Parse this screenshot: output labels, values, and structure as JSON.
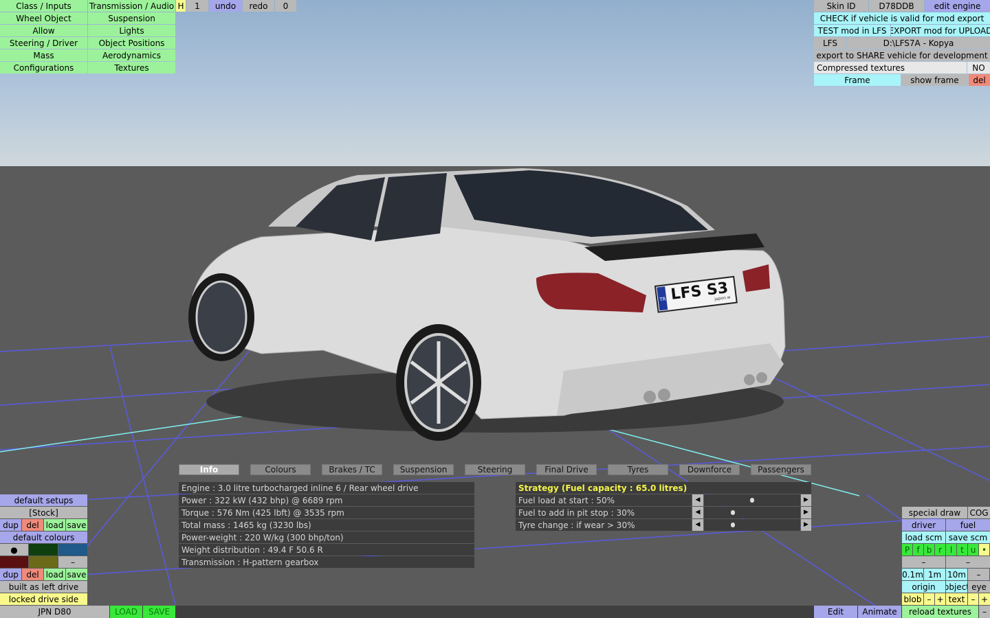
{
  "top_left_menu": [
    [
      "Class / Inputs",
      "Transmission / Audio"
    ],
    [
      "Wheel Object",
      "Suspension"
    ],
    [
      "Allow",
      "Lights"
    ],
    [
      "Steering / Driver",
      "Object Positions"
    ],
    [
      "Mass",
      "Aerodynamics"
    ],
    [
      "Configurations",
      "Textures"
    ]
  ],
  "history": {
    "h": "H",
    "count": "1",
    "undo": "undo",
    "redo": "redo",
    "redo_count": "0"
  },
  "top_right": {
    "skin_id_label": "Skin ID",
    "skin_id_value": "D78DDB",
    "edit_engine": "edit engine",
    "check_valid": "CHECK if vehicle is valid for mod export",
    "test_mod": "TEST mod in LFS",
    "export_mod": "EXPORT mod for UPLOAD",
    "lfs_label": "LFS",
    "lfs_path": "D:\\LFS7A - Kopya",
    "export_share": "export to SHARE vehicle for development",
    "compressed_label": "Compressed textures",
    "compressed_value": "NO",
    "frame": "Frame",
    "show_frame": "show frame",
    "del": "del"
  },
  "car": {
    "plate_text": "LFS S3",
    "plate_country": "TR",
    "plate_dealer": "japon.w"
  },
  "tabs": [
    "Info",
    "Colours",
    "Brakes / TC",
    "Suspension",
    "Steering",
    "Final Drive",
    "Tyres",
    "Downforce",
    "Passengers"
  ],
  "info_lines": [
    "Engine : 3.0 litre turbocharged inline 6 / Rear wheel drive",
    "Power : 322 kW (432 bhp) @ 6689 rpm",
    "Torque : 576 Nm (425 lbft) @ 3535 rpm",
    "Total mass : 1465 kg (3230 lbs)",
    "Power-weight : 220 W/kg (300 bhp/ton)",
    "Weight distribution : 49.4 F  50.6 R",
    "Transmission : H-pattern gearbox"
  ],
  "strategy": {
    "title": "Strategy (Fuel capacity : 65.0 litres)",
    "rows": [
      {
        "label": "Fuel load at start : 50%",
        "value": 0.5
      },
      {
        "label": "Fuel to add in pit stop : 30%",
        "value": 0.3
      },
      {
        "label": "Tyre change : if wear > 30%",
        "value": 0.3
      }
    ],
    "left_arrow": "◀",
    "right_arrow": "▶"
  },
  "left_panel": {
    "default_setups": "default setups",
    "stock": "[Stock]",
    "dup": "dup",
    "del": "del",
    "load": "load",
    "save": "save",
    "default_colours": "default colours",
    "dot": "●",
    "dash": "–",
    "built_as": "built as left drive",
    "locked": "locked drive side",
    "vehicle": "JPN D80",
    "load_btn": "LOAD",
    "save_btn": "SAVE"
  },
  "right_panel": {
    "special_draw": "special draw",
    "cog": "COG",
    "driver": "driver",
    "fuel": "fuel",
    "load_scm": "load scm",
    "save_scm": "save scm",
    "letters": [
      "P",
      "f",
      "b",
      "r",
      "l",
      "t",
      "u",
      "•"
    ],
    "dash": "–",
    "dist": [
      "0.1m",
      "1m",
      "10m",
      "–"
    ],
    "origin": "origin",
    "object": "object",
    "eye": "eye",
    "blob": "blob",
    "minus": "–",
    "plus": "+",
    "text": "text",
    "edit": "Edit",
    "animate": "Animate",
    "reload": "reload textures"
  },
  "colours": {
    "swatch_dark_green": "#0f3f0f",
    "swatch_blue": "#1f5a8a",
    "swatch_dark_red": "#5a1010",
    "swatch_olive": "#6a6a18"
  }
}
